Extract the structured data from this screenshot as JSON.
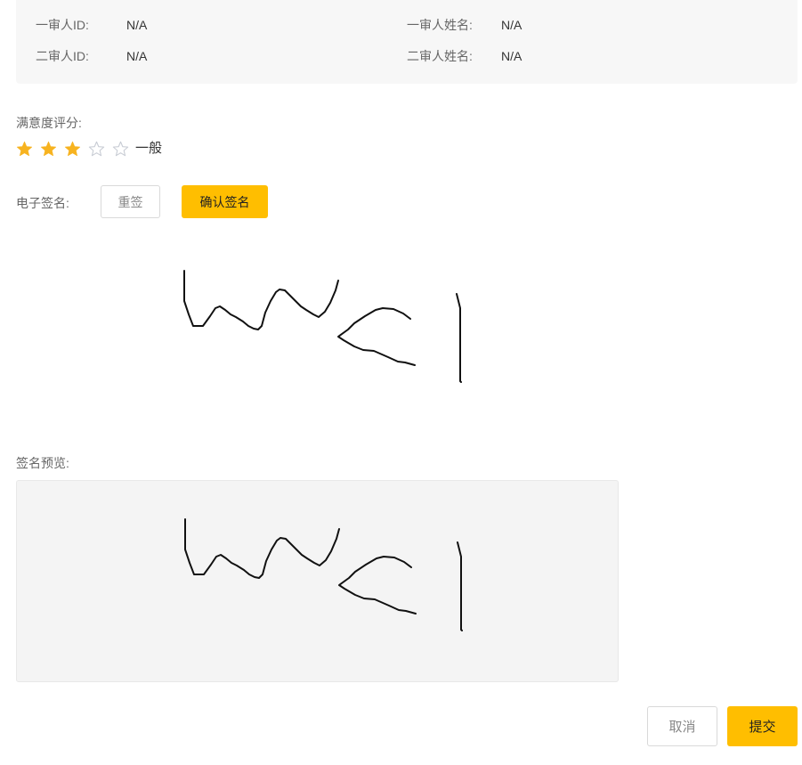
{
  "reviewers": {
    "row1": {
      "id_label": "一审人ID:",
      "id_value": "N/A",
      "name_label": "一审人姓名:",
      "name_value": "N/A"
    },
    "row2": {
      "id_label": "二审人ID:",
      "id_value": "N/A",
      "name_label": "二审人姓名:",
      "name_value": "N/A"
    }
  },
  "rating": {
    "label": "满意度评分:",
    "value": 3,
    "max": 5,
    "text": "一般",
    "filled_color": "#f7b320",
    "empty_color": "#c8ccd4"
  },
  "signature": {
    "label": "电子签名:",
    "reset_label": "重签",
    "confirm_label": "确认签名"
  },
  "preview": {
    "label": "签名预览:"
  },
  "footer": {
    "cancel_label": "取消",
    "submit_label": "提交"
  },
  "colors": {
    "accent": "#ffbe00",
    "info_bg": "#f7f7f7",
    "preview_bg": "#f4f4f4"
  }
}
